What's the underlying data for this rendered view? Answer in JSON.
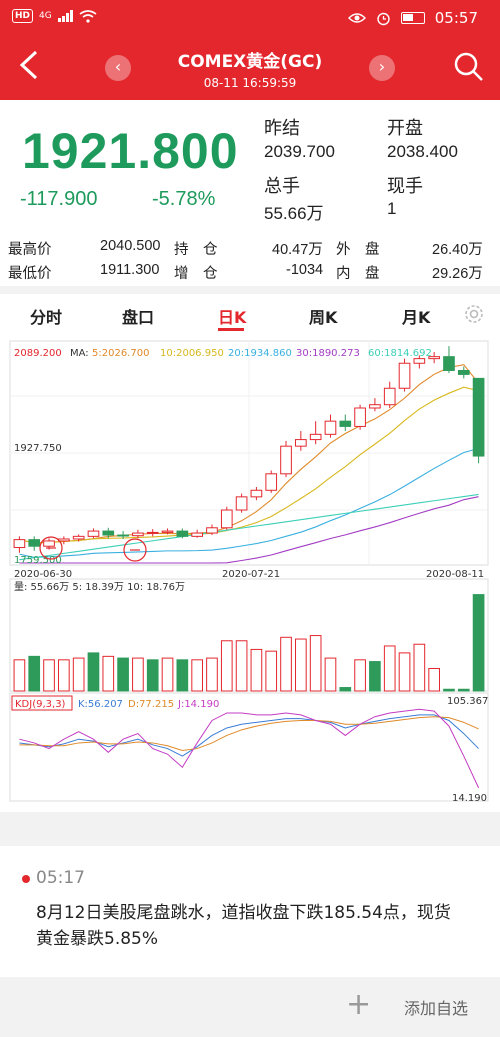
{
  "status_bar": {
    "network": "HD",
    "signal": "4G",
    "time": "05:57"
  },
  "header": {
    "title": "COMEX黄金(GC)",
    "timestamp": "08-11 16:59:59"
  },
  "quote": {
    "price": "1921.800",
    "change": "-117.900",
    "change_pct": "-5.78%",
    "prev_settle_label": "昨结",
    "prev_settle": "2039.700",
    "open_label": "开盘",
    "open": "2038.400",
    "total_volume_label": "总手",
    "total_volume": "55.66万",
    "current_volume_label": "现手",
    "current_volume": "1"
  },
  "stats": {
    "row1": {
      "l1": "最高价",
      "v1": "2040.500",
      "l2": "持　仓",
      "v2": "40.47万",
      "l3": "外　盘",
      "v3": "26.40万"
    },
    "row2": {
      "l1": "最低价",
      "v1": "1911.300",
      "l2": "增　仓",
      "v2": "-1034",
      "l3": "内　盘",
      "v3": "29.26万"
    }
  },
  "tabs": [
    "分时",
    "盘口",
    "日K",
    "周K",
    "月K"
  ],
  "active_tab": "日K",
  "chart": {
    "price_high_label": "2089.200",
    "price_mid_label": "1927.750",
    "price_low_label": "1759.500",
    "ma_title": "MA:",
    "ma_labels": [
      {
        "text": "5:2026.700",
        "color": "#e08a2a"
      },
      {
        "text": "10:2006.950",
        "color": "#d8b81e"
      },
      {
        "text": "20:1934.860",
        "color": "#3ab0e0"
      },
      {
        "text": "30:1890.273",
        "color": "#a23cc4"
      },
      {
        "text": "60:1814.692",
        "color": "#3ccfb8"
      }
    ],
    "dates": [
      "2020-06-30",
      "2020-07-21",
      "2020-08-11"
    ],
    "volume_label": "量: 55.66万  5: 18.39万  10: 18.76万",
    "kdj_label": "KDJ(9,3,3)",
    "kdj_k": "K:56.207",
    "kdj_d": "D:77.215",
    "kdj_j": "J:14.190",
    "kdj_max": "105.367",
    "kdj_min": "14.190",
    "up_color": "#e3272d",
    "down_color": "#2e9b5a"
  },
  "chart_data": {
    "type": "candlestick",
    "x": [
      "2020-06-30",
      "2020-07-21",
      "2020-08-11"
    ],
    "ylim": [
      1759.5,
      2089.2
    ],
    "candles": [
      {
        "o": 1783,
        "c": 1795,
        "h": 1800,
        "l": 1775
      },
      {
        "o": 1795,
        "c": 1785,
        "h": 1800,
        "l": 1778
      },
      {
        "o": 1785,
        "c": 1793,
        "h": 1797,
        "l": 1780
      },
      {
        "o": 1793,
        "c": 1796,
        "h": 1800,
        "l": 1788
      },
      {
        "o": 1796,
        "c": 1800,
        "h": 1803,
        "l": 1792
      },
      {
        "o": 1800,
        "c": 1808,
        "h": 1812,
        "l": 1797
      },
      {
        "o": 1808,
        "c": 1802,
        "h": 1813,
        "l": 1797
      },
      {
        "o": 1802,
        "c": 1801,
        "h": 1808,
        "l": 1796
      },
      {
        "o": 1801,
        "c": 1805,
        "h": 1810,
        "l": 1797
      },
      {
        "o": 1805,
        "c": 1806,
        "h": 1811,
        "l": 1800
      },
      {
        "o": 1806,
        "c": 1808,
        "h": 1812,
        "l": 1803
      },
      {
        "o": 1808,
        "c": 1800,
        "h": 1812,
        "l": 1797
      },
      {
        "o": 1800,
        "c": 1805,
        "h": 1810,
        "l": 1798
      },
      {
        "o": 1805,
        "c": 1813,
        "h": 1818,
        "l": 1802
      },
      {
        "o": 1813,
        "c": 1840,
        "h": 1845,
        "l": 1810
      },
      {
        "o": 1840,
        "c": 1860,
        "h": 1865,
        "l": 1836
      },
      {
        "o": 1860,
        "c": 1870,
        "h": 1875,
        "l": 1855
      },
      {
        "o": 1870,
        "c": 1895,
        "h": 1900,
        "l": 1866
      },
      {
        "o": 1895,
        "c": 1937,
        "h": 1945,
        "l": 1890
      },
      {
        "o": 1937,
        "c": 1947,
        "h": 1960,
        "l": 1930
      },
      {
        "o": 1947,
        "c": 1955,
        "h": 1975,
        "l": 1940
      },
      {
        "o": 1955,
        "c": 1975,
        "h": 1985,
        "l": 1950
      },
      {
        "o": 1975,
        "c": 1967,
        "h": 1985,
        "l": 1960
      },
      {
        "o": 1967,
        "c": 1995,
        "h": 2000,
        "l": 1962
      },
      {
        "o": 1995,
        "c": 2000,
        "h": 2010,
        "l": 1990
      },
      {
        "o": 2000,
        "c": 2025,
        "h": 2035,
        "l": 1995
      },
      {
        "o": 2025,
        "c": 2063,
        "h": 2070,
        "l": 2020
      },
      {
        "o": 2063,
        "c": 2070,
        "h": 2075,
        "l": 2055
      },
      {
        "o": 2070,
        "c": 2073,
        "h": 2080,
        "l": 2063
      },
      {
        "o": 2073,
        "c": 2052,
        "h": 2089,
        "l": 2048
      },
      {
        "o": 2052,
        "c": 2046,
        "h": 2058,
        "l": 2040
      },
      {
        "o": 2040,
        "c": 1922,
        "h": 2040,
        "l": 1911
      }
    ],
    "volume": [
      {
        "v": 18,
        "up": true
      },
      {
        "v": 20,
        "up": false
      },
      {
        "v": 18,
        "up": true
      },
      {
        "v": 18,
        "up": true
      },
      {
        "v": 19,
        "up": true
      },
      {
        "v": 22,
        "up": false
      },
      {
        "v": 20,
        "up": true
      },
      {
        "v": 19,
        "up": false
      },
      {
        "v": 19,
        "up": true
      },
      {
        "v": 18,
        "up": false
      },
      {
        "v": 19,
        "up": true
      },
      {
        "v": 18,
        "up": false
      },
      {
        "v": 18,
        "up": true
      },
      {
        "v": 19,
        "up": true
      },
      {
        "v": 29,
        "up": true
      },
      {
        "v": 29,
        "up": true
      },
      {
        "v": 24,
        "up": true
      },
      {
        "v": 23,
        "up": true
      },
      {
        "v": 31,
        "up": true
      },
      {
        "v": 30,
        "up": true
      },
      {
        "v": 32,
        "up": true
      },
      {
        "v": 19,
        "up": true
      },
      {
        "v": 2,
        "up": false
      },
      {
        "v": 18,
        "up": true
      },
      {
        "v": 17,
        "up": false
      },
      {
        "v": 26,
        "up": true
      },
      {
        "v": 22,
        "up": true
      },
      {
        "v": 27,
        "up": true
      },
      {
        "v": 13,
        "up": true
      },
      {
        "v": 1,
        "up": false
      },
      {
        "v": 1,
        "up": false
      },
      {
        "v": 55.66,
        "up": false
      }
    ]
  },
  "news": {
    "time": "05:17",
    "text": "8月12日美股尾盘跳水，道指收盘下跌185.54点，现货黄金暴跌5.85%"
  },
  "bottom": {
    "add_label": "添加自选"
  }
}
